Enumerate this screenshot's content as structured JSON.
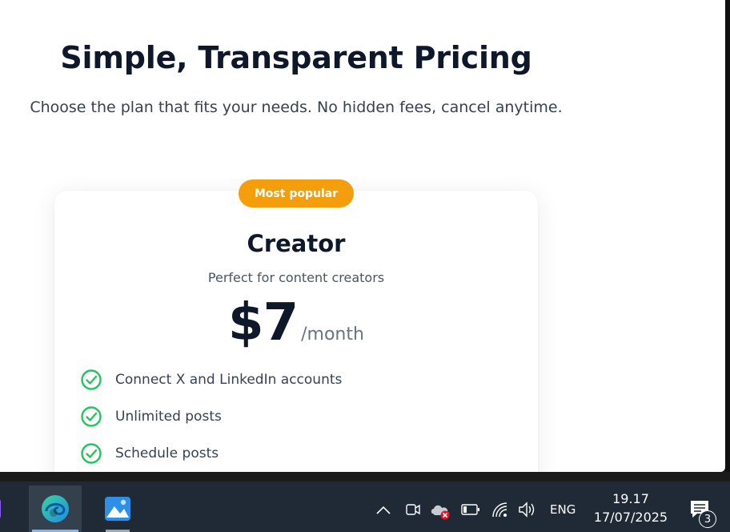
{
  "page": {
    "title": "Simple, Transparent Pricing",
    "subtitle": "Choose the plan that fits your needs. No hidden fees, cancel anytime."
  },
  "plan": {
    "badge": "Most popular",
    "name": "Creator",
    "description": "Perfect for content creators",
    "price": "$7",
    "period": "/month",
    "features": [
      "Connect X and LinkedIn accounts",
      "Unlimited posts",
      "Schedule posts"
    ]
  },
  "colors": {
    "badge": "#f59e0b",
    "check": "#22c55e",
    "heading": "#0f172a",
    "taskbar": "#1f2a36"
  },
  "taskbar": {
    "apps": [
      "visual-studio-icon",
      "edge-icon",
      "photos-icon"
    ],
    "language": "ENG",
    "time": "19.17",
    "date": "17/07/2025",
    "notification_count": "3"
  }
}
